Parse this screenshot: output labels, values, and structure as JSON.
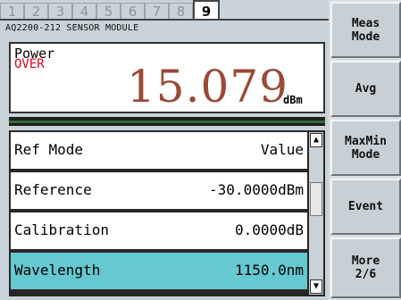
{
  "tabs": [
    "1",
    "2",
    "3",
    "4",
    "5",
    "6",
    "7",
    "8",
    "9"
  ],
  "module_title": "AQ2200-212 SENSOR MODULE",
  "measurement": {
    "label": "Power",
    "status": "OVER",
    "value": "15.079",
    "unit": "dBm"
  },
  "params": [
    {
      "label": "Ref Mode",
      "value": "Value"
    },
    {
      "label": "Reference",
      "value": "-30.0000dBm"
    },
    {
      "label": "Calibration",
      "value": "0.0000dB"
    },
    {
      "label": "Wavelength",
      "value": "1150.0nm"
    }
  ],
  "scroll": {
    "up": "▲",
    "down": "▼"
  },
  "softkeys": {
    "meas_mode": "Meas\nMode",
    "avg": "Avg",
    "maxmin_mode": "MaxMin\nMode",
    "event": "Event",
    "more": "More\n2/6"
  },
  "colors": {
    "value_text": "#9a4a36",
    "over_text": "#e0001a",
    "selected_row": "#66c8d0"
  }
}
